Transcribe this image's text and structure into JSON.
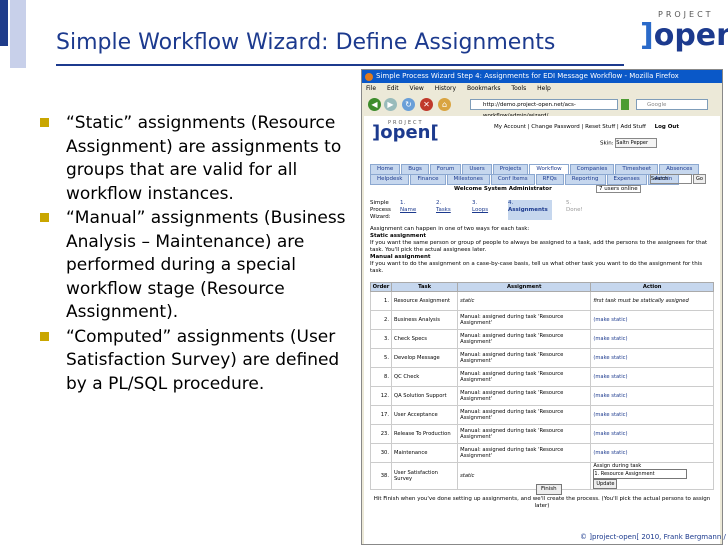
{
  "slide": {
    "title": "Simple Workflow Wizard: Define Assignments",
    "logo_top": "PROJECT",
    "logo_main": "open",
    "bullets": [
      "“Static” assignments (Resource Assignment) are assignments to groups that are valid for all workflow instances.",
      "“Manual” assignments (Business Analysis – Maintenance) are performed during a special workflow stage (Resource Assignment).",
      "“Computed” assignments (User Satisfaction Survey) are defined by a PL/SQL procedure."
    ],
    "footer": "© ]project-open[ 2010, Frank Bergmann / 15"
  },
  "browser": {
    "window_title": "Simple Process Wizard Step 4: Assignments for EDI Message Workflow - Mozilla Firefox",
    "menu": [
      "File",
      "Edit",
      "View",
      "History",
      "Bookmarks",
      "Tools",
      "Help"
    ],
    "url": "http://demo.project-open.net/acs-workflow/admin/wizard/",
    "search_placeholder": "Google"
  },
  "app": {
    "logo_top": "PROJECT",
    "logo_main": "]open[",
    "top_links": "My Account | Change Password | Reset Stuff | Add Stuff",
    "logout": "Log Out",
    "skin_label": "Skin:",
    "skin_value": "Saltn Pepper",
    "tabs_row1": [
      "Home",
      "Bugs",
      "Forum",
      "Users",
      "Projects",
      "Workflow",
      "Companies",
      "Timesheet",
      "Absences"
    ],
    "tabs_row2": [
      "Helpdesk",
      "Finance",
      "Milestones",
      "Conf Items",
      "RFQs",
      "Reporting",
      "Expenses",
      "Admin"
    ],
    "search_value": "Search",
    "search_go": "Go",
    "welcome": "Welcome System Administrator",
    "users_online": "7 users online",
    "steps_label": "Simple Process Wizard:",
    "steps": [
      {
        "num": "1.",
        "name": "Name"
      },
      {
        "num": "2.",
        "name": "Tasks"
      },
      {
        "num": "3.",
        "name": "Loops"
      },
      {
        "num": "4.",
        "name": "Assignments"
      },
      {
        "num": "5.",
        "name": "Done!"
      }
    ],
    "intro": "Assignment can happen in one of two ways for each task:",
    "static_heading": "Static assignment",
    "static_text": "If you want the same person or group of people to always be assigned to a task, add the persons to the assignees for that task. You'll pick the actual assignees later.",
    "manual_heading": "Manual assignment",
    "manual_text": "If you want to do the assignment on a case-by-case basis, tell us what other task you want to do the assignment for this task.",
    "table_headers": [
      "Order",
      "Task",
      "Assignment",
      "Action"
    ],
    "rows": [
      {
        "order": "1.",
        "task": "Resource Assignment",
        "assignment": "static",
        "action": "first task must be statically assigned"
      },
      {
        "order": "2.",
        "task": "Business Analysis",
        "assignment": "Manual: assigned during task 'Resource Assignment'",
        "action": "(make static)"
      },
      {
        "order": "3.",
        "task": "Check Specs",
        "assignment": "Manual: assigned during task 'Resource Assignment'",
        "action": "(make static)"
      },
      {
        "order": "5.",
        "task": "Develop Message",
        "assignment": "Manual: assigned during task 'Resource Assignment'",
        "action": "(make static)"
      },
      {
        "order": "8.",
        "task": "QC Check",
        "assignment": "Manual: assigned during task 'Resource Assignment'",
        "action": "(make static)"
      },
      {
        "order": "12.",
        "task": "QA Solution Support",
        "assignment": "Manual: assigned during task 'Resource Assignment'",
        "action": "(make static)"
      },
      {
        "order": "17.",
        "task": "User Acceptance",
        "assignment": "Manual: assigned during task 'Resource Assignment'",
        "action": "(make static)"
      },
      {
        "order": "23.",
        "task": "Release To Production",
        "assignment": "Manual: assigned during task 'Resource Assignment'",
        "action": "(make static)"
      },
      {
        "order": "30.",
        "task": "Maintenance",
        "assignment": "Manual: assigned during task 'Resource Assignment'",
        "action": "(make static)"
      },
      {
        "order": "38.",
        "task": "User Satisfaction Survey",
        "assignment": "static",
        "action_label": "Assign during task",
        "select_value": "1. Resource Assignment",
        "update": "Update"
      }
    ],
    "finish_button": "Finish",
    "finish_note": "Hit Finish when you've done setting up assignments, and we'll create the process. (You'll pick the actual persons to assign later)"
  }
}
